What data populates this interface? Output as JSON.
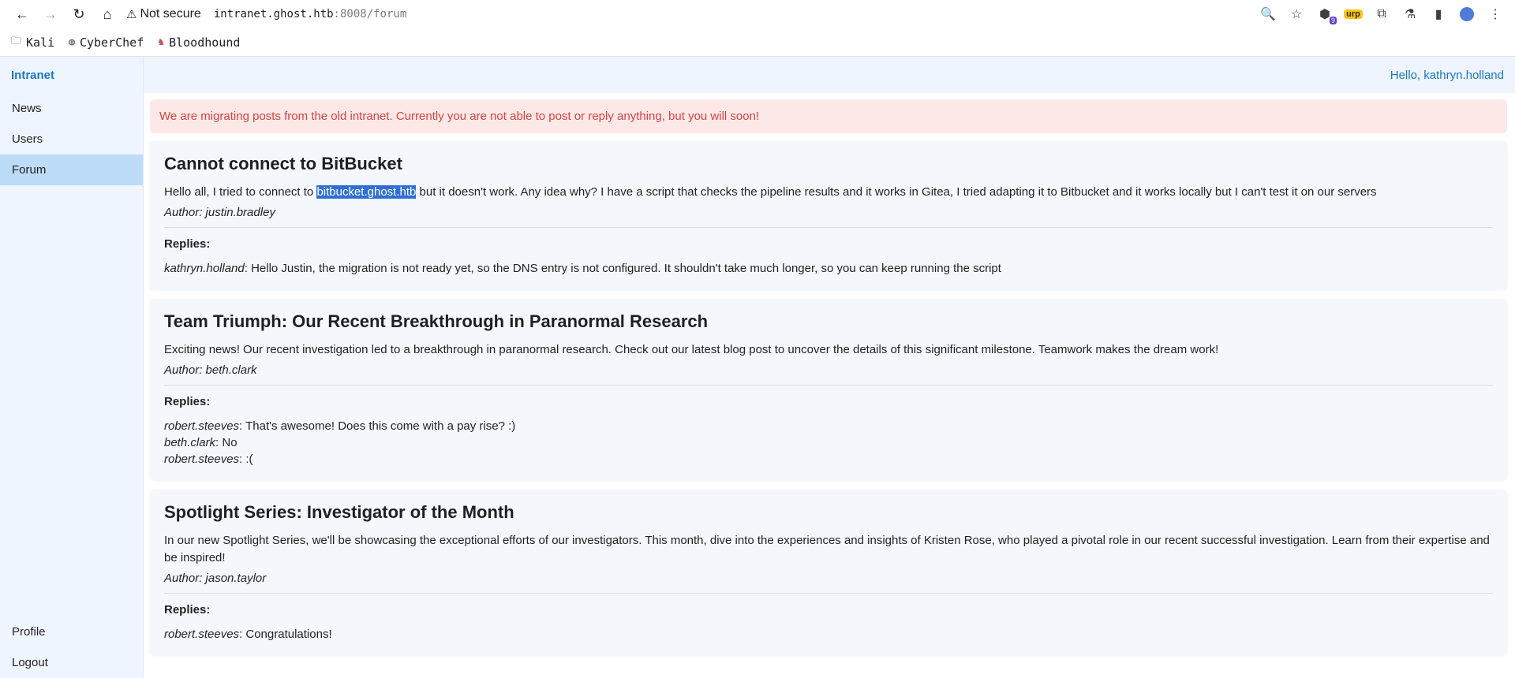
{
  "browser": {
    "security_label": "Not secure",
    "url_host": "intranet.ghost.htb",
    "url_rest": ":8008/forum",
    "bookmarks": [
      {
        "label": "Kali",
        "icon": "folder-icon"
      },
      {
        "label": "CyberChef",
        "icon": "cyberchef-icon"
      },
      {
        "label": "Bloodhound",
        "icon": "bloodhound-icon"
      }
    ],
    "ext_badge": "9",
    "burp_label": "urp"
  },
  "app": {
    "brand": "Intranet",
    "greeting": "Hello, kathryn.holland",
    "sidebar": {
      "items": [
        {
          "label": "News"
        },
        {
          "label": "Users"
        },
        {
          "label": "Forum",
          "active": true
        }
      ],
      "bottom_items": [
        {
          "label": "Profile"
        },
        {
          "label": "Logout"
        }
      ]
    },
    "alert": "We are migrating posts from the old intranet. Currently you are not able to post or reply anything, but you will soon!",
    "replies_label": "Replies:",
    "posts": [
      {
        "title": "Cannot connect to BitBucket",
        "body_before": "Hello all, I tried to connect to ",
        "body_highlight": "bitbucket.ghost.htb",
        "body_after": " but it doesn't work. Any idea why? I have a script that checks the pipeline results and it works in Gitea, I tried adapting it to Bitbucket and it works locally but I can't test it on our servers",
        "author": "Author: justin.bradley",
        "replies": [
          {
            "user": "kathryn.holland",
            "text": ": Hello Justin, the migration is not ready yet, so the DNS entry is not configured. It shouldn't take much longer, so you can keep running the script"
          }
        ]
      },
      {
        "title": "Team Triumph: Our Recent Breakthrough in Paranormal Research",
        "body": "Exciting news! Our recent investigation led to a breakthrough in paranormal research. Check out our latest blog post to uncover the details of this significant milestone. Teamwork makes the dream work!",
        "author": "Author: beth.clark",
        "replies": [
          {
            "user": "robert.steeves",
            "text": ": That's awesome! Does this come with a pay rise? :)"
          },
          {
            "user": "beth.clark",
            "text": ": No"
          },
          {
            "user": "robert.steeves",
            "text": ": :("
          }
        ]
      },
      {
        "title": "Spotlight Series: Investigator of the Month",
        "body": "In our new Spotlight Series, we'll be showcasing the exceptional efforts of our investigators. This month, dive into the experiences and insights of Kristen Rose, who played a pivotal role in our recent successful investigation. Learn from their expertise and be inspired!",
        "author": "Author: jason.taylor",
        "replies": [
          {
            "user": "robert.steeves",
            "text": ": Congratulations!"
          }
        ]
      }
    ]
  }
}
